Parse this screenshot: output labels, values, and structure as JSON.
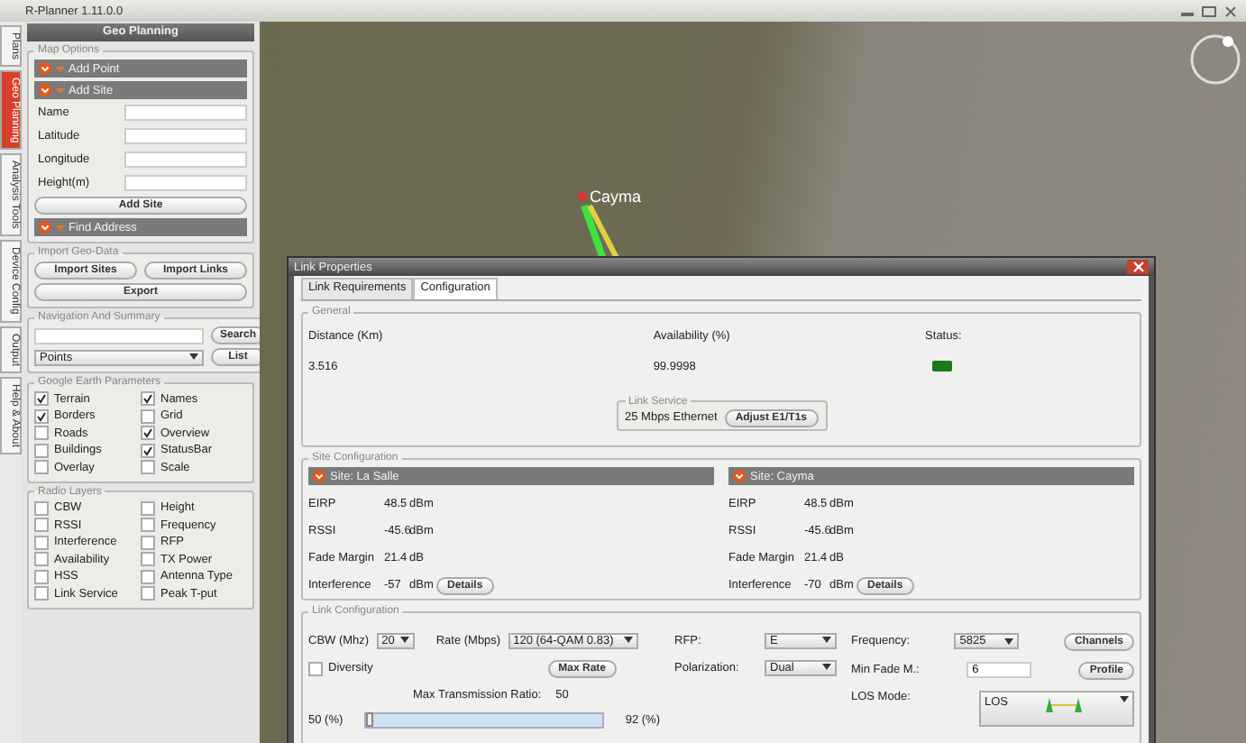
{
  "window": {
    "title": "R-Planner 1.11.0.0"
  },
  "side_tabs": [
    {
      "label": "Plans",
      "selected": false
    },
    {
      "label": "Geo Planning",
      "selected": true
    },
    {
      "label": "Analysis Tools",
      "selected": false
    },
    {
      "label": "Device Config",
      "selected": false
    },
    {
      "label": "Output",
      "selected": false
    },
    {
      "label": "Help & About",
      "selected": false
    }
  ],
  "panel": {
    "title": "Geo Planning",
    "map_options": {
      "title": "Map Options",
      "add_point": "Add Point",
      "add_site": "Add Site",
      "fields": [
        {
          "label": "Name"
        },
        {
          "label": "Latitude"
        },
        {
          "label": "Longitude"
        },
        {
          "label": "Height(m)"
        }
      ],
      "add_site_button": "Add Site",
      "find_address": "Find Address"
    },
    "import": {
      "title": "Import Geo-Data",
      "buttons": [
        "Import Sites",
        "Import Links"
      ],
      "export": "Export"
    },
    "navigation": {
      "title": "Navigation And Summary",
      "search_button": "Search",
      "dropdown": "Points",
      "list_button": "List"
    },
    "earth_params": {
      "title": "Google Earth Parameters",
      "items": [
        {
          "label": "Terrain",
          "checked": true
        },
        {
          "label": "Names",
          "checked": true
        },
        {
          "label": "Borders",
          "checked": true
        },
        {
          "label": "Grid",
          "checked": false
        },
        {
          "label": "Roads",
          "checked": false
        },
        {
          "label": "Overview",
          "checked": true
        },
        {
          "label": "Buildings",
          "checked": false
        },
        {
          "label": "StatusBar",
          "checked": true
        },
        {
          "label": "Overlay",
          "checked": false
        },
        {
          "label": "Scale",
          "checked": false
        }
      ]
    },
    "radio_layers": {
      "title": "Radio Layers",
      "items": [
        {
          "label": "CBW",
          "checked": false
        },
        {
          "label": "Height",
          "checked": false
        },
        {
          "label": "RSSI",
          "checked": false
        },
        {
          "label": "Frequency",
          "checked": false
        },
        {
          "label": "Interference",
          "checked": false
        },
        {
          "label": "RFP",
          "checked": false
        },
        {
          "label": "Availability",
          "checked": false
        },
        {
          "label": "TX Power",
          "checked": false
        },
        {
          "label": "HSS",
          "checked": false
        },
        {
          "label": "Antenna Type",
          "checked": false
        },
        {
          "label": "Link Service",
          "checked": false
        },
        {
          "label": "Peak T-put",
          "checked": false
        }
      ]
    }
  },
  "map": {
    "placemark": "Cayma"
  },
  "dialog": {
    "title": "Link Properties",
    "tabs": [
      {
        "label": "Link Requirements",
        "selected": false
      },
      {
        "label": "Configuration",
        "selected": true
      }
    ],
    "general": {
      "title": "General",
      "distance_label": "Distance (Km)",
      "distance": "3.516",
      "availability_label": "Availability (%)",
      "availability": "99.9998",
      "status_label": "Status:",
      "status_ok": true,
      "link_service": {
        "title": "Link Service",
        "value": "25 Mbps Ethernet",
        "button": "Adjust E1/T1s"
      }
    },
    "site_config": {
      "title": "Site Configuration",
      "sites": [
        {
          "name": "Site: La Salle",
          "rows": [
            {
              "label": "EIRP",
              "value": "48.5",
              "unit": "dBm"
            },
            {
              "label": "RSSI",
              "value": "-45.6",
              "unit": "dBm"
            },
            {
              "label": "Fade Margin",
              "value": "21.4",
              "unit": "dB"
            },
            {
              "label": "Interference",
              "value": "-57",
              "unit": "dBm"
            }
          ],
          "details": "Details"
        },
        {
          "name": "Site: Cayma",
          "rows": [
            {
              "label": "EIRP",
              "value": "48.5",
              "unit": "dBm"
            },
            {
              "label": "RSSI",
              "value": "-45.6",
              "unit": "dBm"
            },
            {
              "label": "Fade Margin",
              "value": "21.4",
              "unit": "dB"
            },
            {
              "label": "Interference",
              "value": "-70",
              "unit": "dBm"
            }
          ],
          "details": "Details"
        }
      ]
    },
    "link_config": {
      "title": "Link Configuration",
      "cbw_label": "CBW (Mhz)",
      "cbw": "20",
      "rate_label": "Rate (Mbps)",
      "rate": "120 (64-QAM 0.83)",
      "rfp_label": "RFP:",
      "rfp": "E",
      "frequency_label": "Frequency:",
      "frequency": "5825",
      "channels_button": "Channels",
      "diversity": {
        "label": "Diversity",
        "checked": false
      },
      "max_rate_button": "Max Rate",
      "polarization_label": "Polarization:",
      "polarization": "Dual",
      "min_fade_label": "Min Fade M.:",
      "min_fade": "6",
      "profile_button": "Profile",
      "max_ratio_label": "Max Transmission Ratio:",
      "max_ratio": "50",
      "slider_min": "50 (%)",
      "slider_max": "92 (%)",
      "slider": {
        "level": 0
      },
      "los_label": "LOS Mode:",
      "los_mode": "LOS"
    }
  }
}
